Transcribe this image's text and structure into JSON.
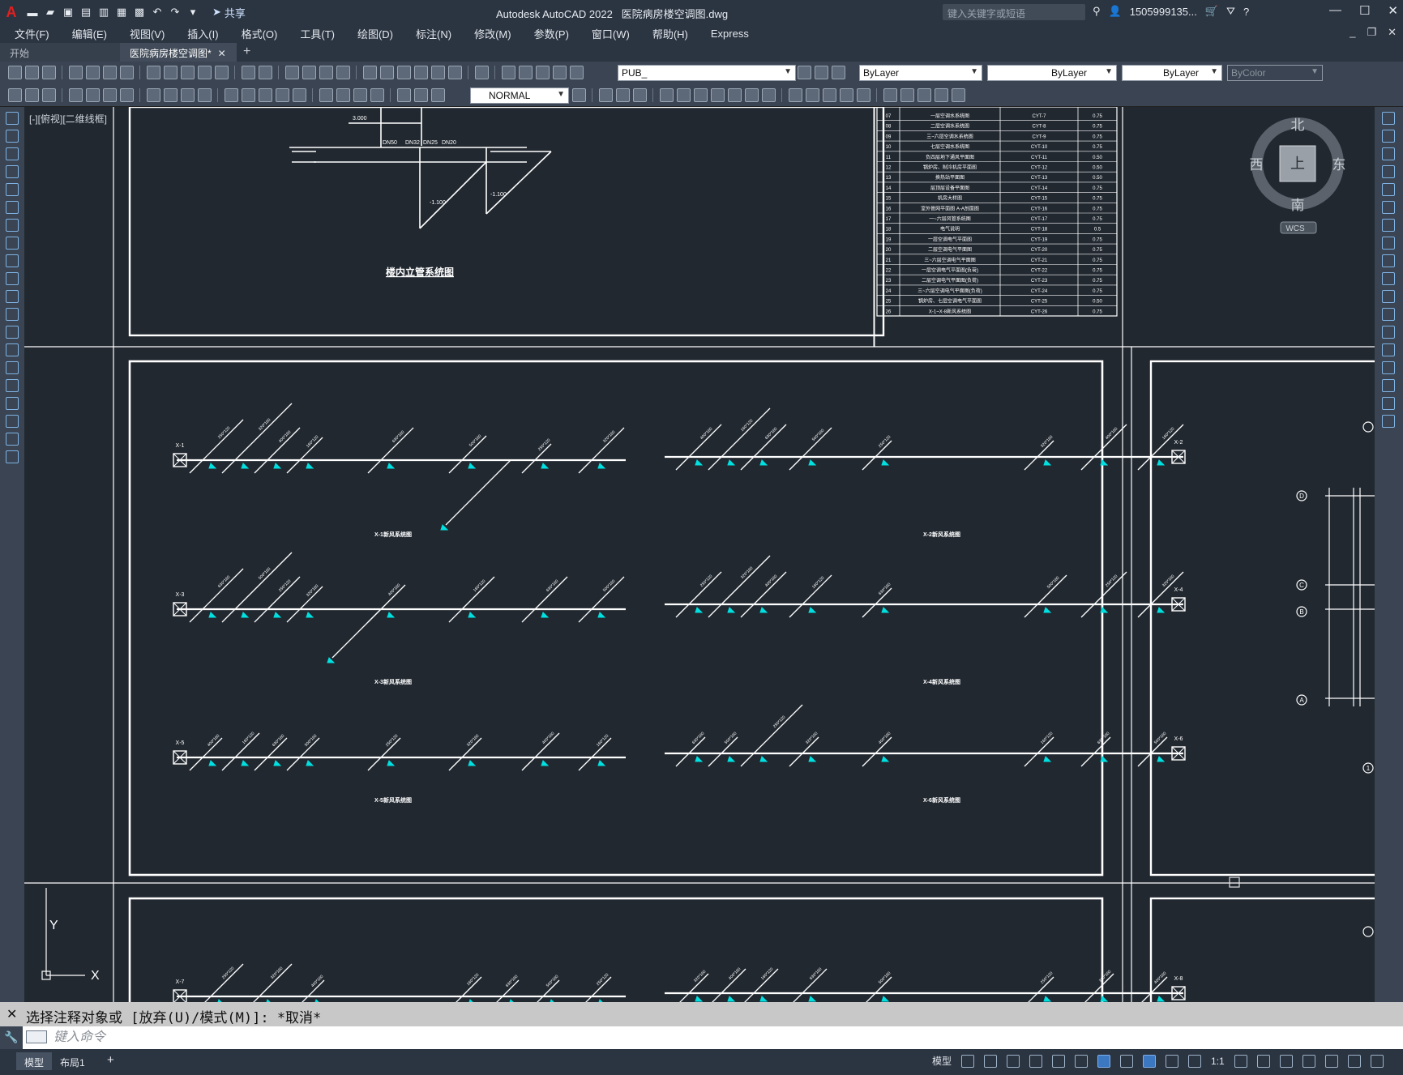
{
  "title_bar": {
    "app_name": "Autodesk AutoCAD 2022",
    "file_name": "医院病房楼空调图.dwg",
    "share_label": "共享",
    "search_placeholder": "键入关键字或短语",
    "user_label": "1505999135...",
    "icons": [
      "autocad-logo-icon",
      "new-icon",
      "open-icon",
      "save-icon",
      "saveas-icon",
      "open-web-icon",
      "save-web-icon",
      "plot-icon",
      "undo-icon",
      "redo-icon",
      "share-icon",
      "search-icon",
      "user-icon",
      "cart-icon",
      "autodesk-icon",
      "help-icon"
    ]
  },
  "menu": {
    "items": [
      "文件(F)",
      "编辑(E)",
      "视图(V)",
      "插入(I)",
      "格式(O)",
      "工具(T)",
      "绘图(D)",
      "标注(N)",
      "修改(M)",
      "参数(P)",
      "窗口(W)",
      "帮助(H)",
      "Express"
    ]
  },
  "tabs": {
    "start_label": "开始",
    "active_label": "医院病房楼空调图*"
  },
  "toolbar": {
    "layer_name": "PUB_",
    "color": "ByLayer",
    "linetype": "ByLayer",
    "lineweight": "ByLayer",
    "plotstyle": "ByColor",
    "dimstyle": "NORMAL"
  },
  "viewport": {
    "view_label": "[-][俯视][二维线框]",
    "viewcube": {
      "north": "北",
      "south": "南",
      "east": "东",
      "west": "西",
      "face": "上",
      "wcs": "WCS"
    },
    "ucs": {
      "x": "X",
      "y": "Y"
    }
  },
  "drawing": {
    "riser_title": "楼内立管系统图",
    "riser_labels": [
      "3.000",
      "DN50",
      "DN32",
      "DN25",
      "DN20",
      "-1.100",
      "-1.100"
    ],
    "table_rows": [
      [
        "07",
        "一层空调水系统图",
        "CYT-7",
        "0.75"
      ],
      [
        "08",
        "二层空调水系统图",
        "CYT-8",
        "0.75"
      ],
      [
        "09",
        "三~六层空调水系统图",
        "CYT-9",
        "0.75"
      ],
      [
        "10",
        "七层空调水系统图",
        "CYT-10",
        "0.75"
      ],
      [
        "11",
        "负四层地下通风平面图",
        "CYT-11",
        "0.50"
      ],
      [
        "12",
        "锅炉房、制冷机房平面图",
        "CYT-12",
        "0.50"
      ],
      [
        "13",
        "换热站平面图",
        "CYT-13",
        "0.50"
      ],
      [
        "14",
        "层顶层设备平面图",
        "CYT-14",
        "0.75"
      ],
      [
        "15",
        "机房大样图",
        "CYT-15",
        "0.75"
      ],
      [
        "16",
        "室外管网平面图 A-A剖面图",
        "CYT-16",
        "0.75"
      ],
      [
        "17",
        "一~六层风管系统图",
        "CYT-17",
        "0.75"
      ],
      [
        "18",
        "电气说明",
        "CYT-18",
        "0.5"
      ],
      [
        "19",
        "一层空调电气平面图",
        "CYT-19",
        "0.75"
      ],
      [
        "20",
        "二层空调电气平面图",
        "CYT-20",
        "0.75"
      ],
      [
        "21",
        "三~六层空调电气平面图",
        "CYT-21",
        "0.75"
      ],
      [
        "22",
        "一层空调电气平面图(负荷)",
        "CYT-22",
        "0.75"
      ],
      [
        "23",
        "二层空调电气平面图(负荷)",
        "CYT-23",
        "0.75"
      ],
      [
        "24",
        "三~六层空调电气平面图(负荷)",
        "CYT-24",
        "0.75"
      ],
      [
        "25",
        "锅炉房、七层空调电气平面图",
        "CYT-25",
        "0.50"
      ],
      [
        "26",
        "X-1~X-8新风系统图",
        "CYT-26",
        "0.75"
      ]
    ],
    "system_captions": [
      "X-1新风系统图",
      "X-2新风系统图",
      "X-3新风系统图",
      "X-4新风系统图",
      "X-5新风系统图",
      "X-6新风系统图"
    ],
    "unit_tags": [
      "X-1",
      "X-2",
      "X-3",
      "X-4",
      "X-5",
      "X-6",
      "X-7",
      "X-8"
    ],
    "duct_labels": [
      "250*120",
      "320*160",
      "400*160",
      "160*120",
      "630*160",
      "500*160"
    ],
    "axis_bubbles": [
      "D",
      "C",
      "B",
      "A",
      "1"
    ]
  },
  "command": {
    "history": "选择注释对象或 [放弃(U)/模式(M)]: *取消*",
    "input_placeholder": "键入命令"
  },
  "status_bar": {
    "model_tab": "模型",
    "layout_tab": "布局1",
    "model_label": "模型",
    "scale": "1:1"
  },
  "colors": {
    "canvas": "#212830",
    "chrome": "#2b3441",
    "toolbar": "#3a4452",
    "duct": "#ffffff",
    "diffuser": "#00e0e0"
  }
}
